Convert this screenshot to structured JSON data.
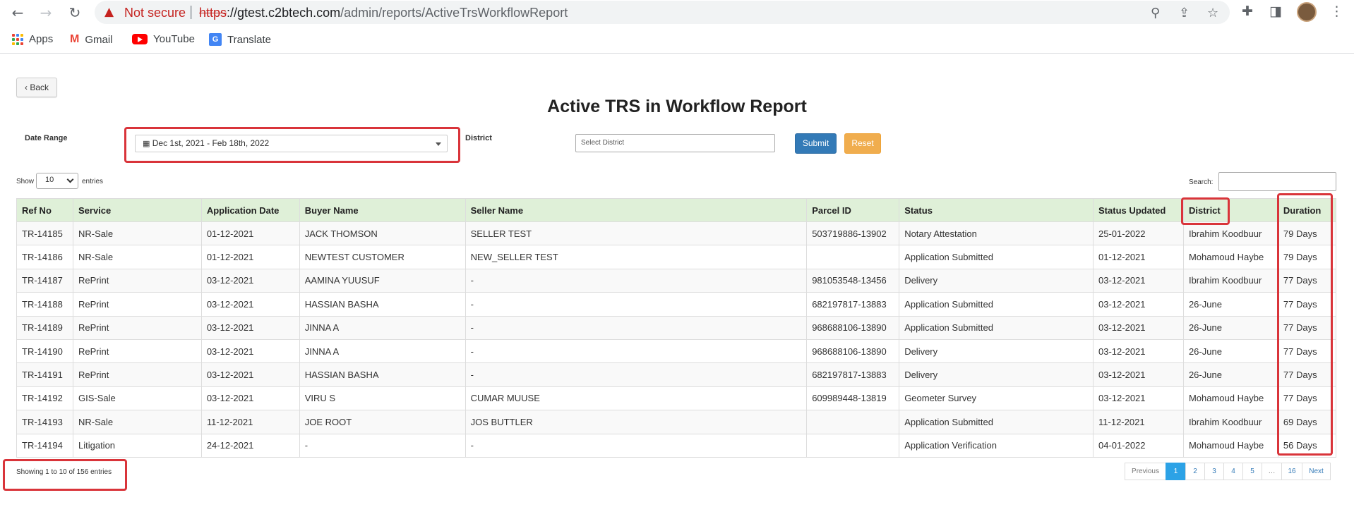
{
  "browser": {
    "not_secure": "Not secure",
    "url_scheme": "https",
    "url_host": "://gtest.c2btech.com",
    "url_path": "/admin/reports/ActiveTrsWorkflowReport",
    "bookmarks": [
      "Apps",
      "Gmail",
      "YouTube",
      "Translate"
    ]
  },
  "page": {
    "back_label": "Back",
    "title": "Active TRS in Workflow Report",
    "date_range_label": "Date Range",
    "date_range_value": "Dec 1st, 2021 - Feb 18th, 2022",
    "district_label": "District",
    "district_placeholder": "Select District",
    "submit_label": "Submit",
    "reset_label": "Reset",
    "show_label": "Show",
    "entries_label": "entries",
    "page_length": "10",
    "search_label": "Search:"
  },
  "table": {
    "columns": [
      "Ref No",
      "Service",
      "Application Date",
      "Buyer Name",
      "Seller Name",
      "Parcel ID",
      "Status",
      "Status Updated",
      "District",
      "Duration"
    ],
    "rows": [
      [
        "TR-14185",
        "NR-Sale",
        "01-12-2021",
        "JACK THOMSON",
        "SELLER TEST",
        "503719886-13902",
        "Notary Attestation",
        "25-01-2022",
        "Ibrahim Koodbuur",
        "79 Days"
      ],
      [
        "TR-14186",
        "NR-Sale",
        "01-12-2021",
        "NEWTEST CUSTOMER",
        "NEW_SELLER TEST",
        "",
        "Application Submitted",
        "01-12-2021",
        "Mohamoud Haybe",
        "79 Days"
      ],
      [
        "TR-14187",
        "RePrint",
        "03-12-2021",
        "AAMINA YUUSUF",
        "-",
        "981053548-13456",
        "Delivery",
        "03-12-2021",
        "Ibrahim Koodbuur",
        "77 Days"
      ],
      [
        "TR-14188",
        "RePrint",
        "03-12-2021",
        "HASSIAN BASHA",
        "-",
        "682197817-13883",
        "Application Submitted",
        "03-12-2021",
        "26-June",
        "77 Days"
      ],
      [
        "TR-14189",
        "RePrint",
        "03-12-2021",
        "JINNA A",
        "-",
        "968688106-13890",
        "Application Submitted",
        "03-12-2021",
        "26-June",
        "77 Days"
      ],
      [
        "TR-14190",
        "RePrint",
        "03-12-2021",
        "JINNA A",
        "-",
        "968688106-13890",
        "Delivery",
        "03-12-2021",
        "26-June",
        "77 Days"
      ],
      [
        "TR-14191",
        "RePrint",
        "03-12-2021",
        "HASSIAN BASHA",
        "-",
        "682197817-13883",
        "Delivery",
        "03-12-2021",
        "26-June",
        "77 Days"
      ],
      [
        "TR-14192",
        "GIS-Sale",
        "03-12-2021",
        "VIRU S",
        "CUMAR MUUSE",
        "609989448-13819",
        "Geometer Survey",
        "03-12-2021",
        "Mohamoud Haybe",
        "77 Days"
      ],
      [
        "TR-14193",
        "NR-Sale",
        "11-12-2021",
        "JOE ROOT",
        "JOS BUTTLER",
        "",
        "Application Submitted",
        "11-12-2021",
        "Ibrahim Koodbuur",
        "69 Days"
      ],
      [
        "TR-14194",
        "Litigation",
        "24-12-2021",
        "-",
        "-",
        "",
        "Application Verification",
        "04-01-2022",
        "Mohamoud Haybe",
        "56 Days"
      ]
    ],
    "info": "Showing 1 to 10 of 156 entries"
  },
  "pagination": [
    "Previous",
    "1",
    "2",
    "3",
    "4",
    "5",
    "…",
    "16",
    "Next"
  ],
  "colors": {
    "header_bg": "#dff0d8",
    "highlight": "#d9343a",
    "submit": "#337ab7",
    "reset": "#f0ad4e",
    "page_active": "#2ca2e6"
  }
}
